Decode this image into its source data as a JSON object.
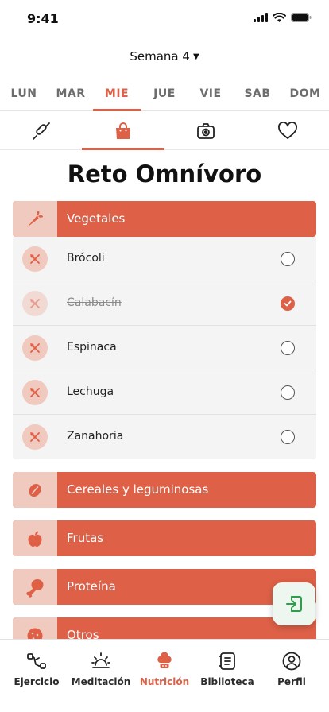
{
  "status_bar": {
    "time": "9:41"
  },
  "week_selector": {
    "label": "Semana 4"
  },
  "days": [
    {
      "label": "LUN",
      "active": false
    },
    {
      "label": "MAR",
      "active": false
    },
    {
      "label": "MIE",
      "active": true
    },
    {
      "label": "JUE",
      "active": false
    },
    {
      "label": "VIE",
      "active": false
    },
    {
      "label": "SAB",
      "active": false
    },
    {
      "label": "DOM",
      "active": false
    }
  ],
  "icon_tabs": [
    {
      "icon": "rolling-pin-icon",
      "active": false
    },
    {
      "icon": "shopping-bag-icon",
      "active": true
    },
    {
      "icon": "camera-icon",
      "active": false
    },
    {
      "icon": "heart-icon",
      "active": false
    }
  ],
  "page_title": "Reto Omnívoro",
  "categories": [
    {
      "label": "Vegetales",
      "icon": "carrot-icon",
      "expanded": true,
      "items": [
        {
          "label": "Brócoli",
          "checked": false
        },
        {
          "label": "Calabacín",
          "checked": true
        },
        {
          "label": "Espinaca",
          "checked": false
        },
        {
          "label": "Lechuga",
          "checked": false
        },
        {
          "label": "Zanahoria",
          "checked": false
        }
      ]
    },
    {
      "label": "Cereales y leguminosas",
      "icon": "bean-icon",
      "expanded": false
    },
    {
      "label": "Frutas",
      "icon": "apple-icon",
      "expanded": false
    },
    {
      "label": "Proteína",
      "icon": "drumstick-icon",
      "expanded": false
    },
    {
      "label": "Otros",
      "icon": "cookie-icon",
      "expanded": false
    }
  ],
  "fab": {
    "icon": "exit-icon"
  },
  "bottom_nav": [
    {
      "label": "Ejercicio",
      "icon": "dumbbell-icon",
      "active": false
    },
    {
      "label": "Meditación",
      "icon": "sunrise-icon",
      "active": false
    },
    {
      "label": "Nutrición",
      "icon": "chef-hat-icon",
      "active": true
    },
    {
      "label": "Biblioteca",
      "icon": "book-icon",
      "active": false
    },
    {
      "label": "Perfil",
      "icon": "user-icon",
      "active": false
    }
  ],
  "colors": {
    "accent": "#dd6047",
    "accent_light": "#f0c9bf",
    "fab_green": "#2e9e4e"
  }
}
